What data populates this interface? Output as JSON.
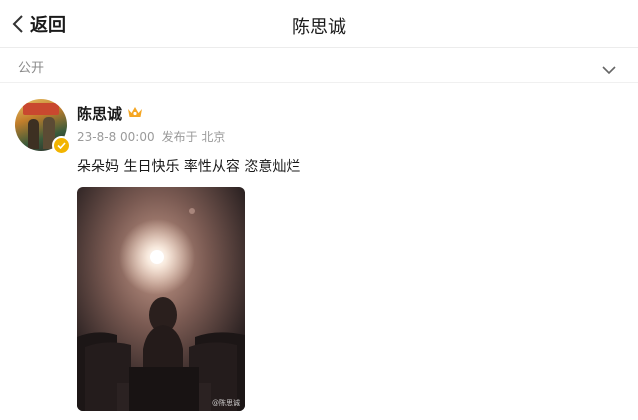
{
  "header": {
    "back_label": "返回",
    "title": "陈思诚"
  },
  "visibility": {
    "label": "公开"
  },
  "post": {
    "author_name": "陈思诚",
    "date": "23-8-8 00:00",
    "location": "发布于 北京",
    "text": "朵朵妈 生日快乐 率性从容 恣意灿烂",
    "image_watermark": "@陈思诚"
  },
  "colors": {
    "verified_badge": "#f2b400",
    "crown": "#f5a623"
  },
  "icons": {
    "back": "chevron-left-icon",
    "visibility": "chevron-down-icon",
    "verified": "verified-badge-icon",
    "membership": "crown-icon"
  }
}
